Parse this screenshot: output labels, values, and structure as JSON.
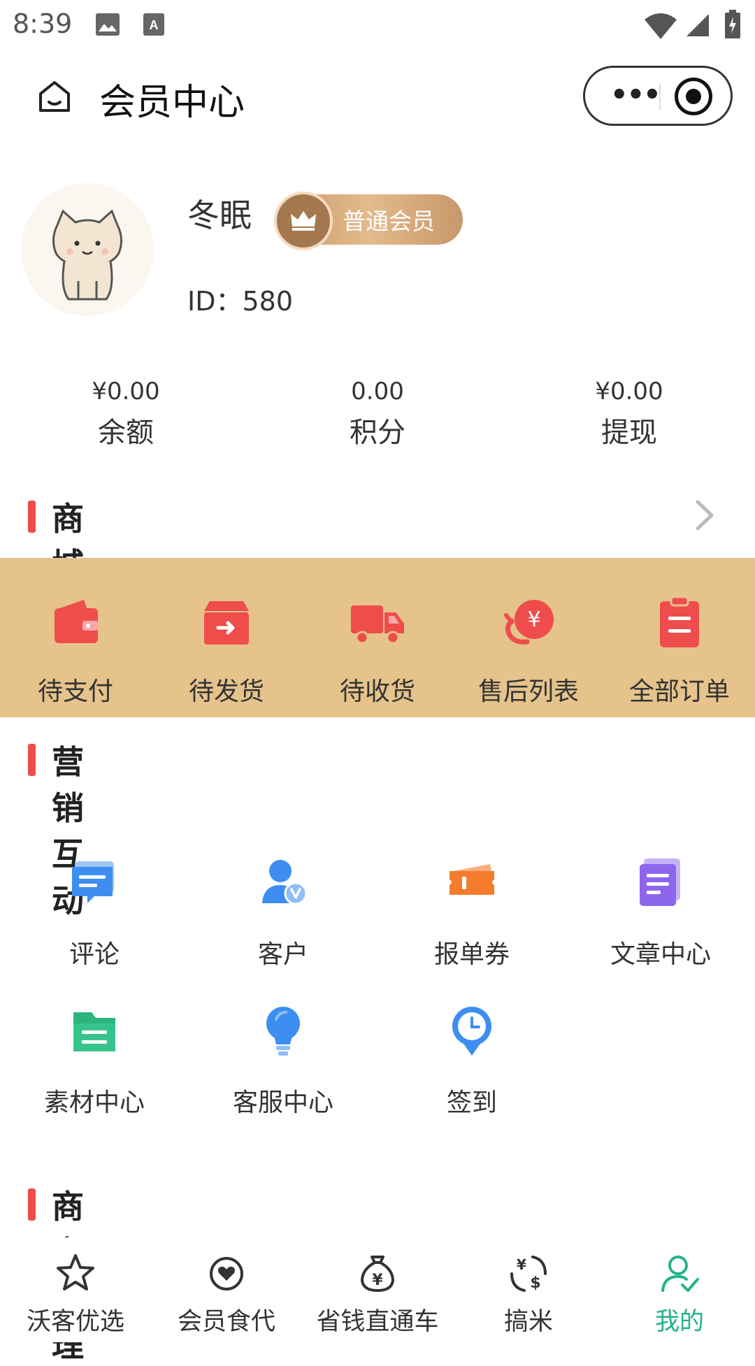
{
  "status_bar": {
    "time": "8:39"
  },
  "nav": {
    "title": "会员中心"
  },
  "profile": {
    "username": "冬眠",
    "member_level": "普通会员",
    "id_label": "ID：",
    "id_value": "580"
  },
  "stats": [
    {
      "value": "¥0.00",
      "label": "余额"
    },
    {
      "value": "0.00",
      "label": "积分"
    },
    {
      "value": "¥0.00",
      "label": "提现"
    }
  ],
  "orders": {
    "title": "商城订单",
    "items": [
      {
        "label": "待支付",
        "icon": "wallet-icon"
      },
      {
        "label": "待发货",
        "icon": "box-icon"
      },
      {
        "label": "待收货",
        "icon": "truck-icon"
      },
      {
        "label": "售后列表",
        "icon": "refund-icon"
      },
      {
        "label": "全部订单",
        "icon": "clipboard-icon"
      }
    ]
  },
  "marketing": {
    "title": "营销互动",
    "items": [
      {
        "label": "评论",
        "icon": "comment-icon"
      },
      {
        "label": "客户",
        "icon": "customer-icon"
      },
      {
        "label": "报单券",
        "icon": "coupon-icon"
      },
      {
        "label": "文章中心",
        "icon": "article-icon"
      },
      {
        "label": "素材中心",
        "icon": "folder-icon"
      },
      {
        "label": "客服中心",
        "icon": "bulb-icon"
      },
      {
        "label": "签到",
        "icon": "clock-pin-icon"
      }
    ]
  },
  "merchant": {
    "title": "商家管理"
  },
  "tabbar": {
    "items": [
      {
        "label": "沃客优选",
        "icon": "star-icon"
      },
      {
        "label": "会员食代",
        "icon": "heart-icon"
      },
      {
        "label": "省钱直通车",
        "icon": "money-bag-icon"
      },
      {
        "label": "搞米",
        "icon": "exchange-icon"
      },
      {
        "label": "我的",
        "icon": "user-check-icon",
        "active": true
      }
    ]
  },
  "colors": {
    "accent_red": "#ef4c4c",
    "order_band": "#e5c38b",
    "active_tab": "#22b38a"
  }
}
